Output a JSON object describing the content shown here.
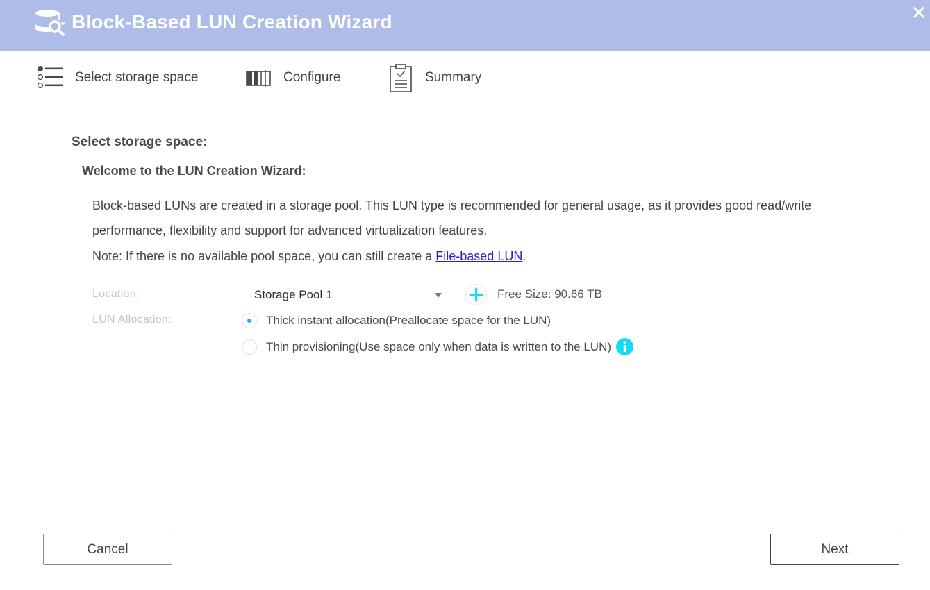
{
  "window": {
    "title": "Block-Based LUN Creation Wizard",
    "icon": "lun-database-icon",
    "close_glyph": "✕"
  },
  "steps": [
    {
      "label": "Select storage space",
      "icon": "list-steps-icon"
    },
    {
      "label": "Configure",
      "icon": "configure-bars-icon"
    },
    {
      "label": "Summary",
      "icon": "clipboard-check-icon"
    }
  ],
  "content": {
    "section_title": "Select storage space:",
    "welcome_title": "Welcome to the LUN Creation Wizard:",
    "description": "Block-based LUNs are created in a storage pool. This LUN type is recommended for general usage, as it provides good read/write performance, flexibility and support for advanced virtualization features.",
    "note_prefix": "Note: If there is no available pool space, you can still create a ",
    "note_link": "File-based LUN",
    "note_suffix": "."
  },
  "form": {
    "location_label": "Location:",
    "location_value": "Storage Pool 1",
    "free_size": "Free Size: 90.66 TB",
    "allocation_label": "LUN Allocation:",
    "allocation_options": [
      {
        "label": "Thick instant allocation(Preallocate space for the LUN)",
        "checked": true
      },
      {
        "label": "Thin provisioning(Use space only when data is written to the LUN)",
        "checked": false
      }
    ]
  },
  "buttons": {
    "cancel": "Cancel",
    "next": "Next"
  },
  "colors": {
    "titlebar": "#aebde8",
    "accent_cyan": "#13dbf5",
    "radio_dot": "#26a6ee",
    "link": "#2323c8"
  }
}
